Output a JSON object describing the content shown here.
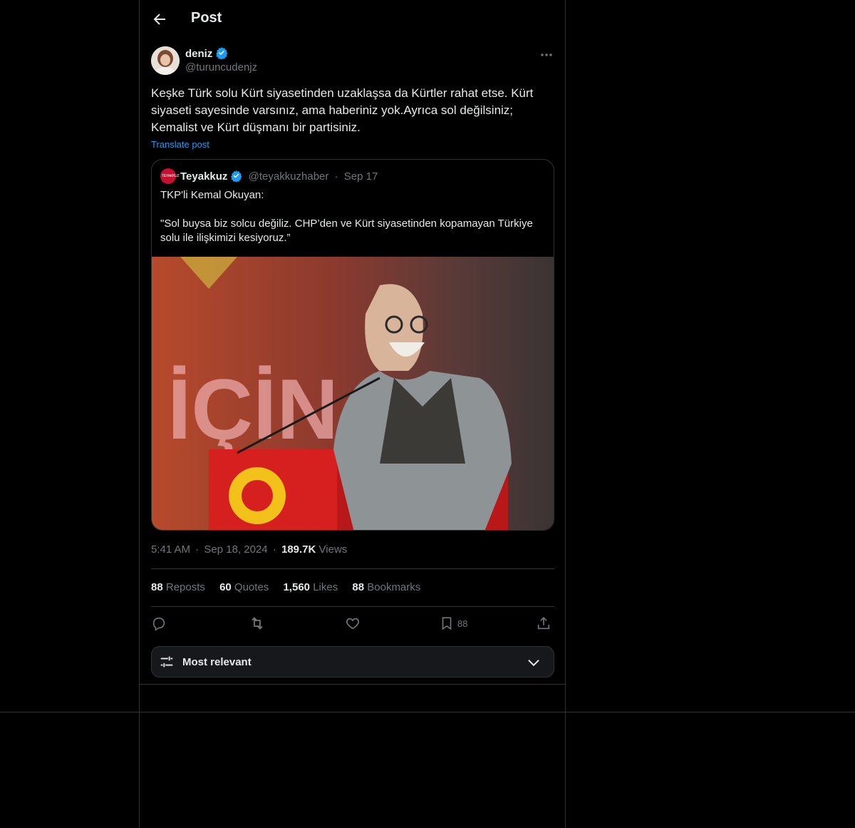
{
  "header": {
    "title": "Post"
  },
  "author": {
    "name": "deniz",
    "handle": "@turuncudenjz"
  },
  "post": {
    "text": "Keşke Türk solu Kürt  siyasetinden uzaklaşsa da Kürtler rahat etse. Kürt siyaseti sayesinde varsınız, ama haberiniz yok.Ayrıca sol değilsiniz; Kemalist ve Kürt düşmanı bir partisiniz.",
    "translate_label": "Translate post"
  },
  "quote": {
    "logo_text": "TEYAKKUZ",
    "name": "Teyakkuz",
    "handle": "@teyakkuzhaber",
    "separator": "·",
    "date": "Sep 17",
    "text": "TKP'li Kemal Okuyan:\n\n\"Sol buysa biz solcu değiliz. CHP’den ve Kürt siyasetinden kopamayan Türkiye solu ile ilişkimizi kesiyoruz.”",
    "image_caption_text": "İÇİN"
  },
  "meta": {
    "time": "5:41 AM",
    "sep1": "·",
    "date": "Sep 18, 2024",
    "sep2": "·",
    "views_count": "189.7K",
    "views_label": "Views"
  },
  "stats": {
    "reposts_count": "88",
    "reposts_label": "Reposts",
    "quotes_count": "60",
    "quotes_label": "Quotes",
    "likes_count": "1,560",
    "likes_label": "Likes",
    "bookmarks_count": "88",
    "bookmarks_label": "Bookmarks"
  },
  "actions": {
    "bookmark_count": "88"
  },
  "sort": {
    "label": "Most relevant"
  },
  "colors": {
    "background": "#000000",
    "border": "#2f3336",
    "accent": "#1d9bf0",
    "muted": "#71767b"
  }
}
